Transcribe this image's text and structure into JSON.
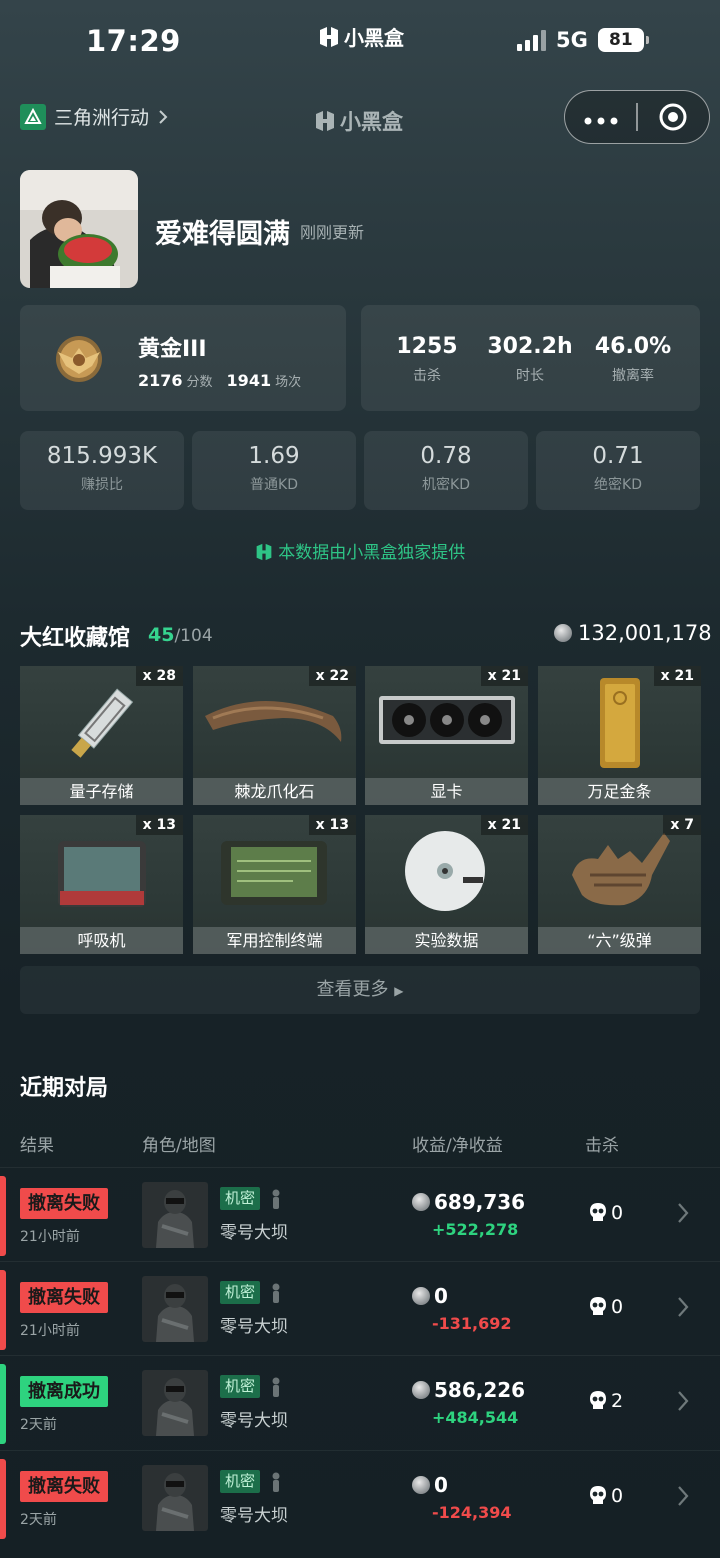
{
  "status_bar": {
    "time": "17:29",
    "brand": "小黑盒",
    "network": "5G",
    "battery": "81"
  },
  "nav": {
    "game_name": "三角洲行动",
    "center_brand": "小黑盒"
  },
  "profile": {
    "username": "爱难得圆满",
    "updated": "刚刚更新"
  },
  "rank": {
    "name": "黄金III",
    "score": "2176",
    "score_label": "分数",
    "matches": "1941",
    "matches_label": "场次"
  },
  "stats": [
    {
      "value": "1255",
      "label": "击杀"
    },
    {
      "value": "302.2h",
      "label": "时长"
    },
    {
      "value": "46.0%",
      "label": "撤离率"
    }
  ],
  "mini_stats": [
    {
      "value": "815.993K",
      "label": "赚损比"
    },
    {
      "value": "1.69",
      "label": "普通KD"
    },
    {
      "value": "0.78",
      "label": "机密KD"
    },
    {
      "value": "0.71",
      "label": "绝密KD"
    }
  ],
  "provided_text": "本数据由小黑盒独家提供",
  "collection": {
    "title": "大红收藏馆",
    "owned": "45",
    "total": "/104",
    "value": "132,001,178",
    "items": [
      {
        "name": "量子存储",
        "qty": "x 28",
        "icon": "usb-drive-icon"
      },
      {
        "name": "棘龙爪化石",
        "qty": "x 22",
        "icon": "claw-fossil-icon"
      },
      {
        "name": "显卡",
        "qty": "x 21",
        "icon": "graphics-card-icon"
      },
      {
        "name": "万足金条",
        "qty": "x 21",
        "icon": "gold-bar-icon"
      },
      {
        "name": "呼吸机",
        "qty": "x 13",
        "icon": "ventilator-icon"
      },
      {
        "name": "军用控制终端",
        "qty": "x 13",
        "icon": "control-terminal-icon"
      },
      {
        "name": "实验数据",
        "qty": "x 21",
        "icon": "data-disc-icon"
      },
      {
        "name": "“六”级弹",
        "qty": "x 7",
        "icon": "hand-sculpture-icon"
      }
    ],
    "see_more": "查看更多"
  },
  "recent": {
    "title": "近期对局",
    "headers": {
      "result": "结果",
      "role_map": "角色/地图",
      "earnings": "收益/净收益",
      "kills": "击杀"
    },
    "rows": [
      {
        "result": "撤离失败",
        "success": false,
        "ago": "21小时前",
        "mode": "机密",
        "map": "零号大坝",
        "earn": "689,736",
        "net": "+522,278",
        "kills": "0"
      },
      {
        "result": "撤离失败",
        "success": false,
        "ago": "21小时前",
        "mode": "机密",
        "map": "零号大坝",
        "earn": "0",
        "net": "-131,692",
        "kills": "0"
      },
      {
        "result": "撤离成功",
        "success": true,
        "ago": "2天前",
        "mode": "机密",
        "map": "零号大坝",
        "earn": "586,226",
        "net": "+484,544",
        "kills": "2"
      },
      {
        "result": "撤离失败",
        "success": false,
        "ago": "2天前",
        "mode": "机密",
        "map": "零号大坝",
        "earn": "0",
        "net": "-124,394",
        "kills": "0"
      }
    ]
  },
  "colors": {
    "success": "#2ed37f",
    "fail": "#f04b4b",
    "accent": "#2ec486"
  }
}
